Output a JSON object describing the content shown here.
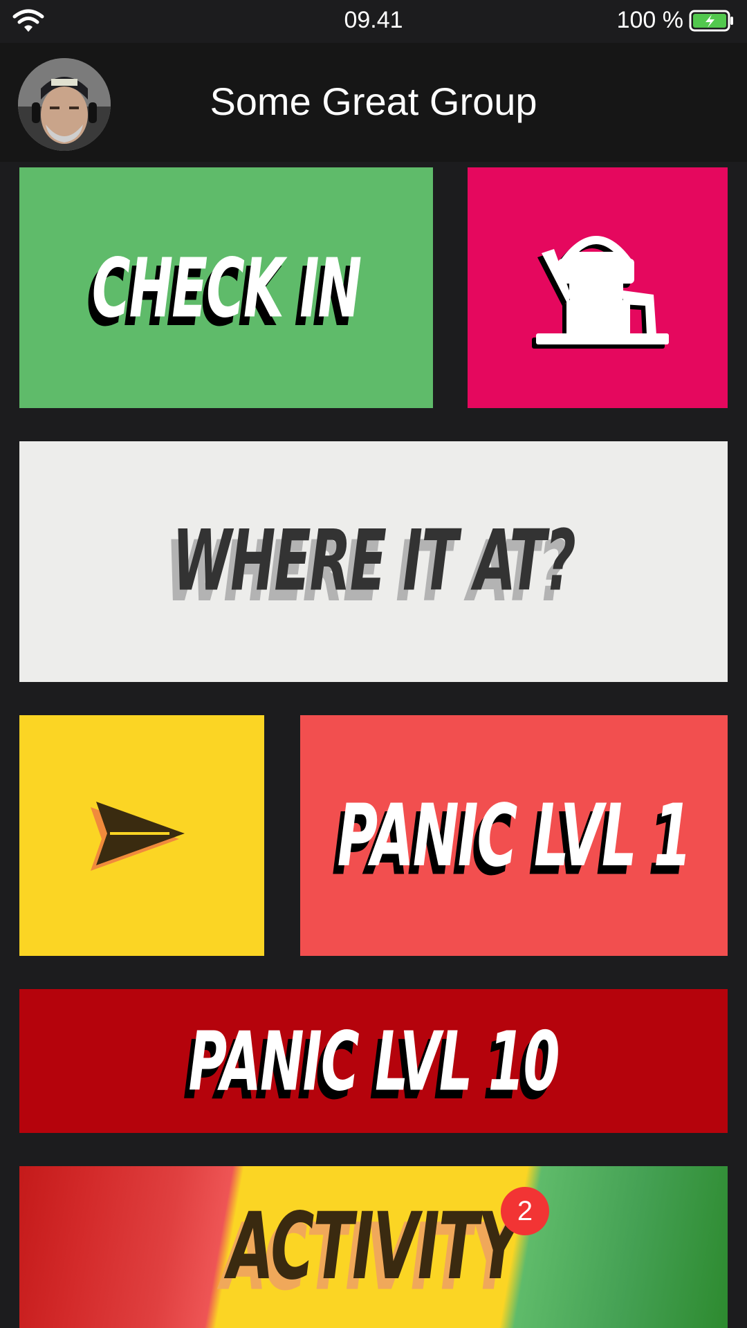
{
  "status_bar": {
    "time": "09.41",
    "battery": "100 %",
    "wifi_icon": "wifi-icon",
    "battery_icon": "battery-charging-icon"
  },
  "header": {
    "title": "Some Great Group",
    "avatar_icon": "user-avatar"
  },
  "tiles": {
    "check_in": {
      "label": "CHECK IN",
      "color": "#5fbb6a"
    },
    "dj": {
      "icon": "dj-headphones-icon",
      "color": "#e5085e"
    },
    "where": {
      "label": "WHERE IT AT?",
      "color": "#ededeb"
    },
    "send": {
      "icon": "send-arrow-icon",
      "color": "#fbd524"
    },
    "panic1": {
      "label": "PANIC LVL 1",
      "color": "#f24f4f"
    },
    "panic10": {
      "label": "PANIC LVL 10",
      "color": "#b5030c"
    },
    "activity": {
      "label": "ACTIVITY",
      "badge": "2"
    }
  }
}
